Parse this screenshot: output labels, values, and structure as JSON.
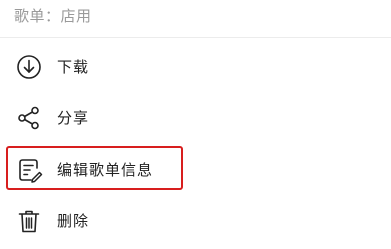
{
  "header": {
    "text": "歌单：店用"
  },
  "menu": {
    "items": [
      {
        "label": "下载",
        "icon": "download-icon"
      },
      {
        "label": "分享",
        "icon": "share-icon"
      },
      {
        "label": "编辑歌单信息",
        "icon": "edit-document-icon"
      },
      {
        "label": "删除",
        "icon": "trash-icon"
      }
    ]
  },
  "colors": {
    "highlight": "#d81e1e",
    "text": "#222222",
    "muted": "#9a9a9a"
  }
}
